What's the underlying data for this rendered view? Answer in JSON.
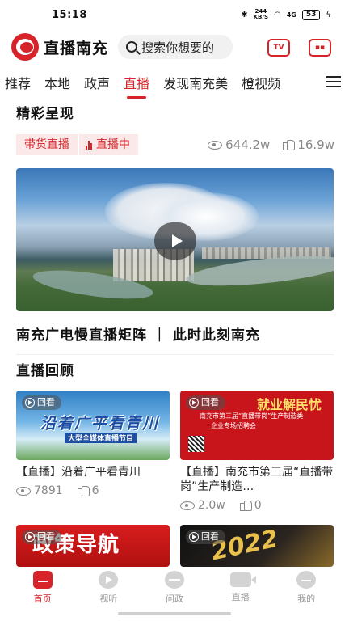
{
  "status_bar": {
    "time": "15:18",
    "net_speed_value": "244",
    "net_speed_unit": "KB/S",
    "signal": "4G",
    "battery": "53"
  },
  "header": {
    "brand": "直播南充",
    "search_placeholder": "搜索你想要的",
    "tv_label": "TV"
  },
  "tabs": [
    {
      "label": "推荐",
      "active": false
    },
    {
      "label": "本地",
      "active": false
    },
    {
      "label": "政声",
      "active": false
    },
    {
      "label": "直播",
      "active": true
    },
    {
      "label": "发现南充美",
      "active": false
    },
    {
      "label": "橙视频",
      "active": false
    }
  ],
  "featured": {
    "section_title": "精彩呈现",
    "tag_category": "带货直播",
    "tag_status": "直播中",
    "views": "644.2w",
    "likes": "16.9w",
    "title": "南充广电慢直播矩阵 ｜ 此时此刻南充"
  },
  "replay": {
    "section_title": "直播回顾",
    "badge": "回看",
    "cards": [
      {
        "title": "【直播】沿着广平看青川",
        "views": "7891",
        "likes": "6",
        "thumb_text": "沿着广平看青川",
        "thumb_sub": "大型全媒体直播节目"
      },
      {
        "title": "【直播】南充市第三届“直播带岗”生产制造…",
        "views": "2.0w",
        "likes": "0",
        "thumb_text": "就业解民忧",
        "thumb_sub": "南充市第三届“直播带岗”生产制造类",
        "thumb_sub2": "企业专场招聘会"
      },
      {
        "title": "",
        "views": "",
        "likes": "",
        "thumb_text": "政策导航"
      },
      {
        "title": "",
        "views": "",
        "likes": "",
        "thumb_text": "2022"
      }
    ]
  },
  "bottom_nav": [
    {
      "label": "首页",
      "icon": "home-icon",
      "active": true
    },
    {
      "label": "视听",
      "icon": "play-icon",
      "active": false
    },
    {
      "label": "问政",
      "icon": "chat-icon",
      "active": false
    },
    {
      "label": "直播",
      "icon": "camera-icon",
      "active": false
    },
    {
      "label": "我的",
      "icon": "profile-icon",
      "active": false
    }
  ],
  "colors": {
    "accent": "#d7242a",
    "muted": "#888888",
    "tag_bg": "#fbe9e9"
  }
}
